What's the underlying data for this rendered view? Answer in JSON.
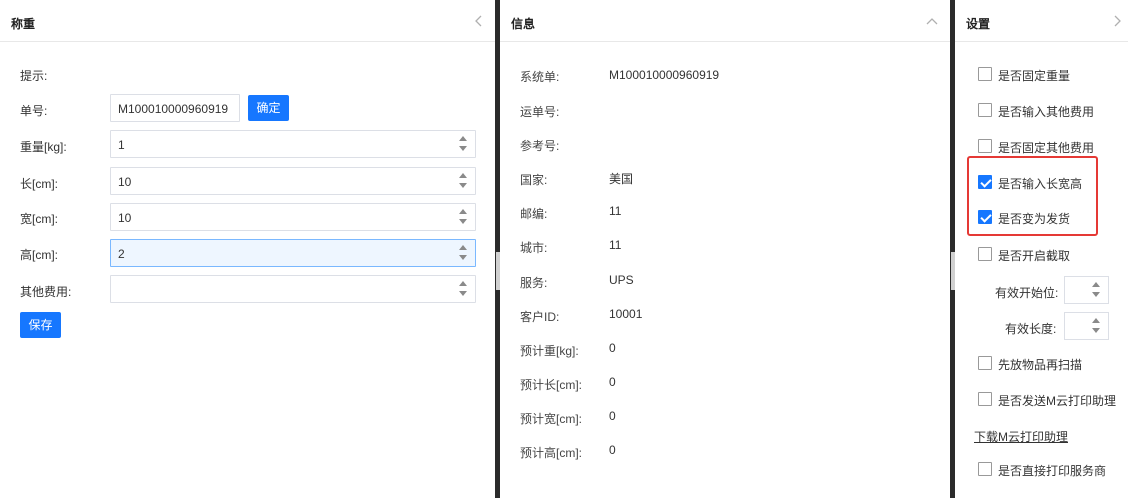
{
  "weigh": {
    "title": "称重",
    "hint_label": "提示:",
    "order_label": "单号:",
    "order_value": "M100010000960919",
    "confirm_label": "确定",
    "weight_label": "重量[kg]:",
    "weight_value": "1",
    "length_label": "长[cm]:",
    "length_value": "10",
    "width_label": "宽[cm]:",
    "width_value": "10",
    "height_label": "高[cm]:",
    "height_value": "2",
    "other_fee_label": "其他费用:",
    "other_fee_value": "",
    "save_label": "保存"
  },
  "info": {
    "title": "信息",
    "rows": [
      {
        "label": "系统单:",
        "value": "M100010000960919"
      },
      {
        "label": "运单号:",
        "value": ""
      },
      {
        "label": "参考号:",
        "value": ""
      },
      {
        "label": "国家:",
        "value": "美国"
      },
      {
        "label": "邮编:",
        "value": "11"
      },
      {
        "label": "城市:",
        "value": "11"
      },
      {
        "label": "服务:",
        "value": "UPS"
      },
      {
        "label": "客户ID:",
        "value": "10001"
      },
      {
        "label": "预计重[kg]:",
        "value": "0"
      },
      {
        "label": "预计长[cm]:",
        "value": "0"
      },
      {
        "label": "预计宽[cm]:",
        "value": "0"
      },
      {
        "label": "预计高[cm]:",
        "value": "0"
      }
    ]
  },
  "settings": {
    "title": "设置",
    "options": [
      {
        "label": "是否固定重量",
        "checked": false
      },
      {
        "label": "是否输入其他费用",
        "checked": false
      },
      {
        "label": "是否固定其他费用",
        "checked": false
      },
      {
        "label": "是否输入长宽高",
        "checked": true
      },
      {
        "label": "是否变为发货",
        "checked": true
      },
      {
        "label": "是否开启截取",
        "checked": false
      }
    ],
    "start_pos_label": "有效开始位:",
    "length_label": "有效长度:",
    "scan_first_label": "先放物品再扫描",
    "send_m_cloud_label": "是否发送M云打印助理",
    "download_link": "下载M云打印助理",
    "direct_print_label": "是否直接打印服务商"
  },
  "colors": {
    "accent": "#1677ff",
    "highlight": "#e53935",
    "divider": "#2b2b2b"
  }
}
